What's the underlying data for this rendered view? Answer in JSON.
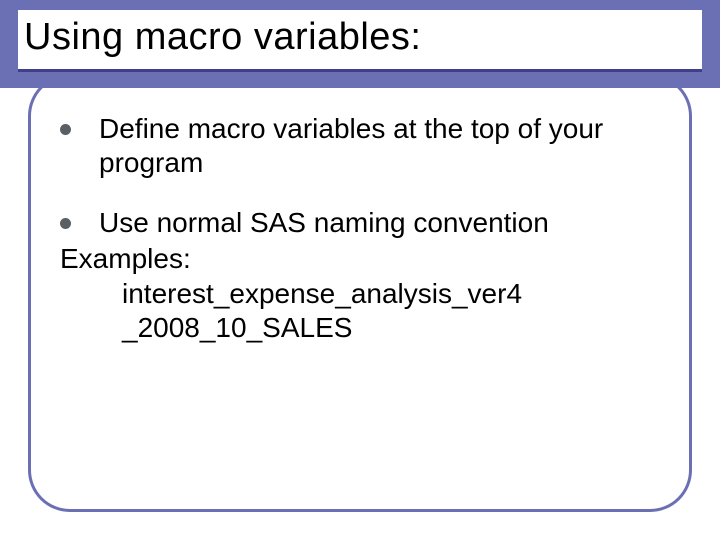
{
  "title": "Using macro variables:",
  "bullets": [
    "Define macro variables at the top of your program",
    "Use normal SAS naming convention"
  ],
  "examples_label": "Examples:",
  "examples": [
    "interest_expense_analysis_ver4",
    "_2008_10_SALES"
  ]
}
